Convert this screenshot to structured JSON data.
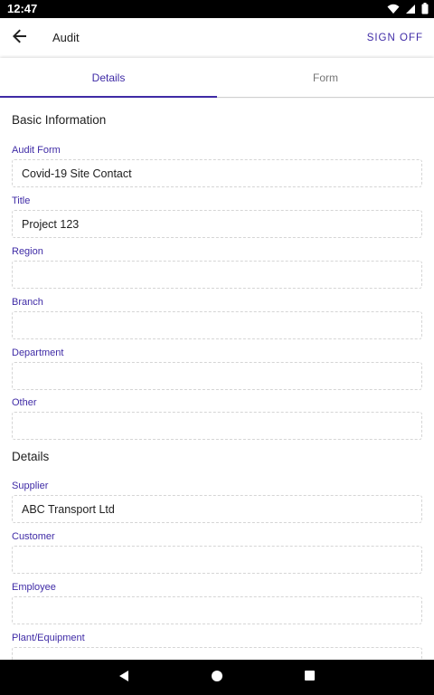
{
  "status_bar": {
    "time": "12:47",
    "icons": [
      "wifi-icon",
      "signal-icon",
      "battery-icon"
    ]
  },
  "app_bar": {
    "back_icon": "arrow-left-icon",
    "title": "Audit",
    "action_label": "SIGN OFF"
  },
  "tabs": [
    {
      "label": "Details",
      "selected": true
    },
    {
      "label": "Form",
      "selected": false
    }
  ],
  "sections": {
    "basic": {
      "title": "Basic Information"
    },
    "details": {
      "title": "Details"
    }
  },
  "fields": {
    "audit_form": {
      "label": "Audit Form",
      "value": "Covid-19 Site Contact"
    },
    "title": {
      "label": "Title",
      "value": "Project 123"
    },
    "region": {
      "label": "Region",
      "value": ""
    },
    "branch": {
      "label": "Branch",
      "value": ""
    },
    "department": {
      "label": "Department",
      "value": ""
    },
    "other": {
      "label": "Other",
      "value": ""
    },
    "supplier": {
      "label": "Supplier",
      "value": "ABC Transport Ltd"
    },
    "customer": {
      "label": "Customer",
      "value": ""
    },
    "employee": {
      "label": "Employee",
      "value": ""
    },
    "plant_equipment": {
      "label": "Plant/Equipment",
      "value": ""
    }
  },
  "nav_bar": {
    "icons": [
      "back-triangle-icon",
      "home-circle-icon",
      "recents-square-icon"
    ]
  },
  "colors": {
    "accent": "#3f2ba6",
    "text": "#212121",
    "muted": "#757575",
    "border": "#d5d5d5"
  }
}
